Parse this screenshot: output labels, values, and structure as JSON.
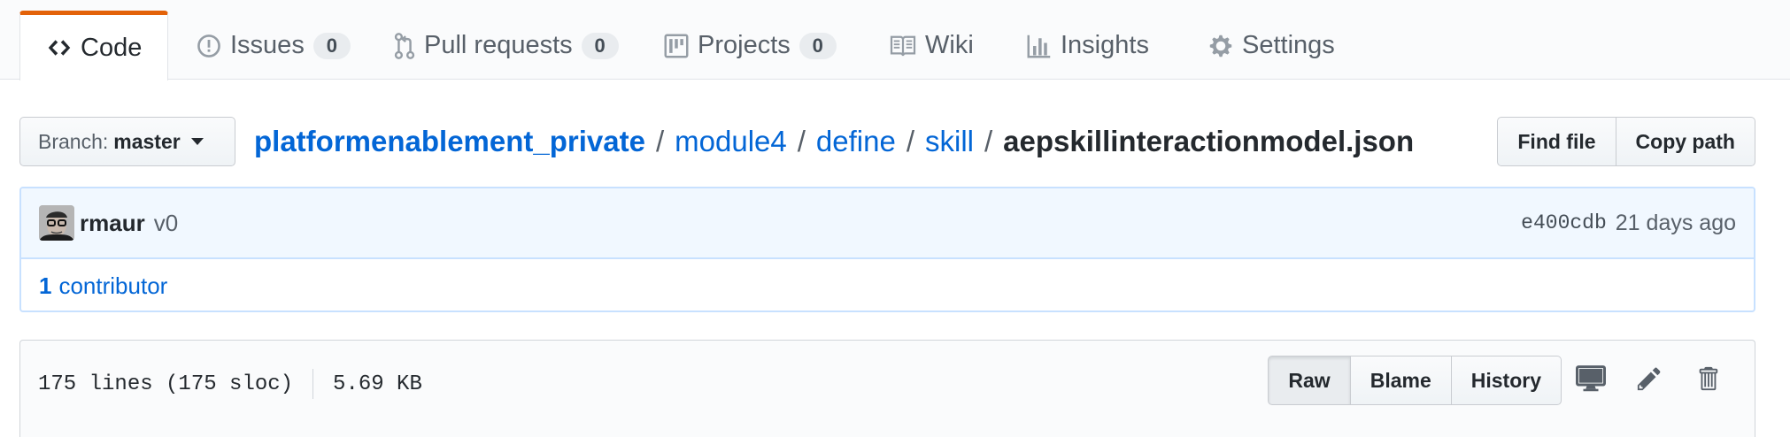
{
  "tabs": [
    {
      "label": "Code",
      "icon": "code-icon",
      "selected": true
    },
    {
      "label": "Issues",
      "icon": "issue-opened-icon",
      "count": "0"
    },
    {
      "label": "Pull requests",
      "icon": "git-pull-request-icon",
      "count": "0"
    },
    {
      "label": "Projects",
      "icon": "project-icon",
      "count": "0"
    },
    {
      "label": "Wiki",
      "icon": "book-icon"
    },
    {
      "label": "Insights",
      "icon": "graph-icon"
    },
    {
      "label": "Settings",
      "icon": "gear-icon"
    }
  ],
  "branch": {
    "label": "Branch:",
    "name": "master"
  },
  "breadcrumb": {
    "repo": "platformenablement_private",
    "path": [
      "module4",
      "define",
      "skill"
    ],
    "separator": "/",
    "file": "aepskillinteractionmodel.json"
  },
  "file_nav": {
    "find_file": "Find file",
    "copy_path": "Copy path"
  },
  "commit": {
    "author": "rmaur",
    "message": "v0",
    "sha": "e400cdb",
    "time": "21 days ago"
  },
  "contributors": {
    "count": "1",
    "label": "contributor"
  },
  "file": {
    "lines": "175 lines (175 sloc)",
    "size": "5.69 KB",
    "raw": "Raw",
    "blame": "Blame",
    "history": "History"
  },
  "colors": {
    "accent": "#e36209",
    "link": "#0366d6",
    "commit_bg": "#f1f8ff",
    "commit_border": "#c8e1ff"
  }
}
